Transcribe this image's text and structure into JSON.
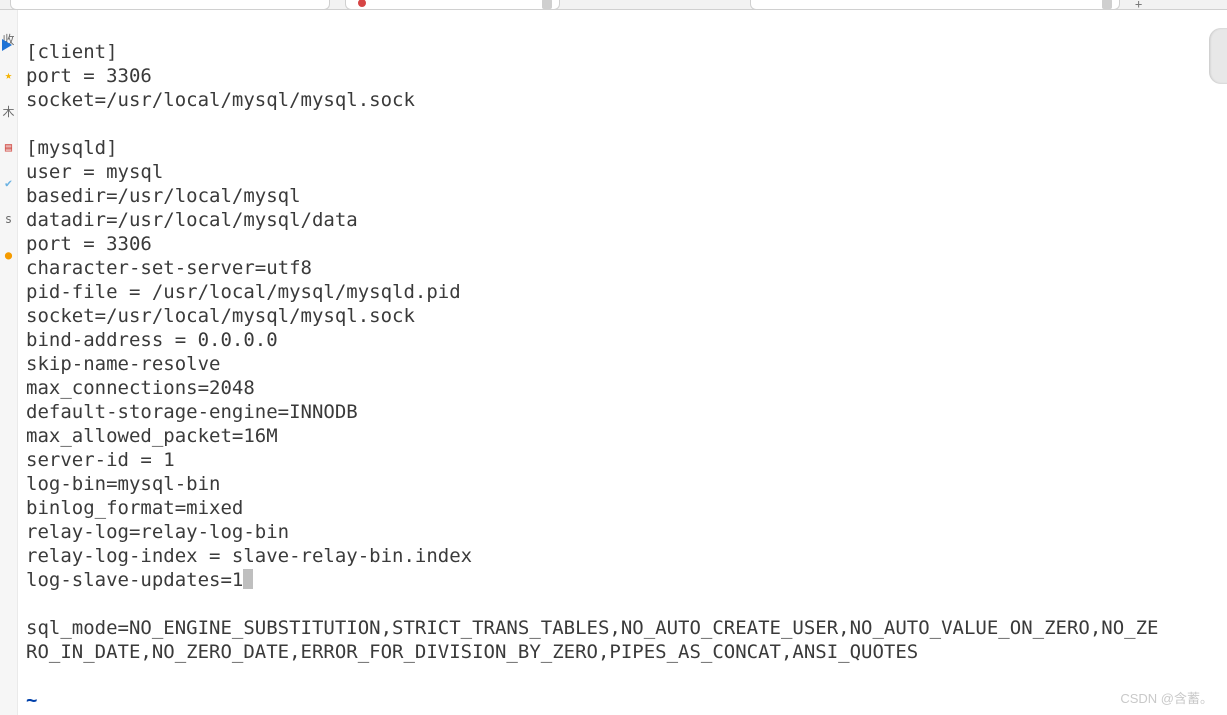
{
  "sidebar": {
    "icons": [
      "favorite",
      "star",
      "tree",
      "doc",
      "check",
      "stop",
      "orange"
    ]
  },
  "config": {
    "l1": "[client]",
    "l2": "port = 3306",
    "l3": "socket=/usr/local/mysql/mysql.sock",
    "l4": "",
    "l5": "[mysqld]",
    "l6": "user = mysql",
    "l7": "basedir=/usr/local/mysql",
    "l8": "datadir=/usr/local/mysql/data",
    "l9": "port = 3306",
    "l10": "character-set-server=utf8",
    "l11": "pid-file = /usr/local/mysql/mysqld.pid",
    "l12": "socket=/usr/local/mysql/mysql.sock",
    "l13": "bind-address = 0.0.0.0",
    "l14": "skip-name-resolve",
    "l15": "max_connections=2048",
    "l16": "default-storage-engine=INNODB",
    "l17": "max_allowed_packet=16M",
    "l18": "server-id = 1",
    "l19": "log-bin=mysql-bin",
    "l20": "binlog_format=mixed",
    "l21": "relay-log=relay-log-bin",
    "l22": "relay-log-index = slave-relay-bin.index",
    "l23": "log-slave-updates=1",
    "l24": "",
    "l25": "sql_mode=NO_ENGINE_SUBSTITUTION,STRICT_TRANS_TABLES,NO_AUTO_CREATE_USER,NO_AUTO_VALUE_ON_ZERO,NO_ZE",
    "l26": "RO_IN_DATE,NO_ZERO_DATE,ERROR_FOR_DIVISION_BY_ZERO,PIPES_AS_CONCAT,ANSI_QUOTES",
    "l27": "",
    "l28": "~"
  },
  "watermark": "CSDN @含蓄。"
}
